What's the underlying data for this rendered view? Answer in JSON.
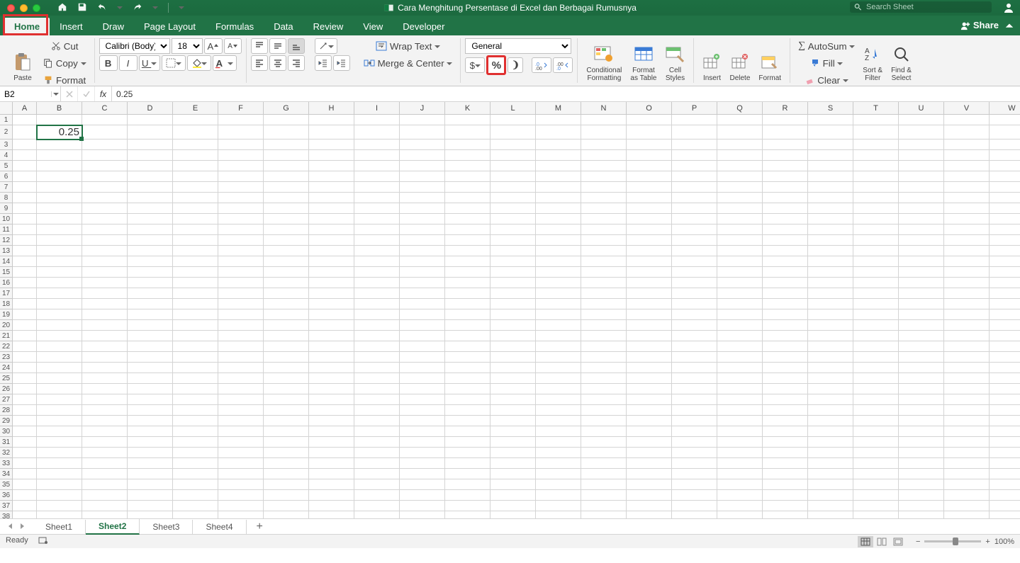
{
  "window": {
    "title": "Cara Menghitung Persentase di Excel dan Berbagai Rumusnya",
    "search_placeholder": "Search Sheet"
  },
  "tabs": {
    "items": [
      "Home",
      "Insert",
      "Draw",
      "Page Layout",
      "Formulas",
      "Data",
      "Review",
      "View",
      "Developer"
    ],
    "active": "Home",
    "share_label": "Share"
  },
  "ribbon": {
    "clipboard": {
      "paste": "Paste",
      "cut": "Cut",
      "copy": "Copy",
      "format": "Format"
    },
    "font": {
      "name": "Calibri (Body)",
      "size": "18"
    },
    "alignment": {
      "wrap": "Wrap Text",
      "merge": "Merge & Center"
    },
    "number": {
      "format": "General",
      "currency": "$",
      "percent": "%",
      "comma": ",",
      "inc": ".0",
      "dec": ".00"
    },
    "styles": {
      "cond": "Conditional\nFormatting",
      "table": "Format\nas Table",
      "cell": "Cell\nStyles"
    },
    "cells": {
      "insert": "Insert",
      "delete": "Delete",
      "format": "Format"
    },
    "editing": {
      "autosum": "AutoSum",
      "fill": "Fill",
      "clear": "Clear",
      "sort": "Sort &\nFilter",
      "find": "Find &\nSelect"
    }
  },
  "formula_bar": {
    "ref": "B2",
    "formula": "0.25"
  },
  "grid": {
    "columns": [
      "A",
      "B",
      "C",
      "D",
      "E",
      "F",
      "G",
      "H",
      "I",
      "J",
      "K",
      "L",
      "M",
      "N",
      "O",
      "P",
      "Q",
      "R",
      "S",
      "T",
      "U",
      "V",
      "W"
    ],
    "rows": 38,
    "active_cell": {
      "col": "B",
      "row": 2,
      "value": "0.25"
    }
  },
  "sheets": {
    "items": [
      "Sheet1",
      "Sheet2",
      "Sheet3",
      "Sheet4"
    ],
    "active": "Sheet2"
  },
  "status": {
    "ready": "Ready",
    "zoom": "100%"
  }
}
